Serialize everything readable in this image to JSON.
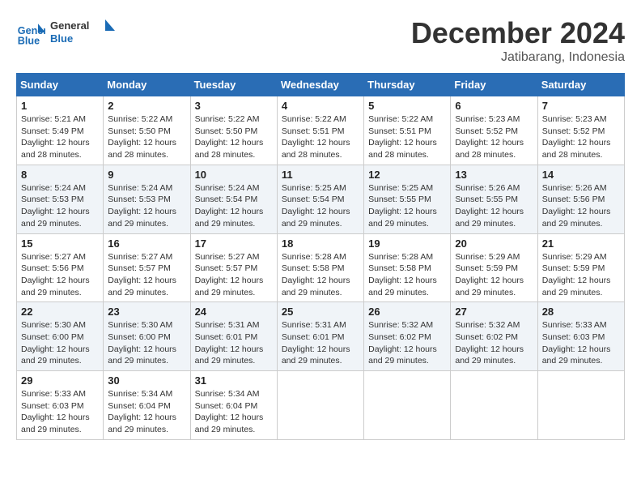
{
  "logo": {
    "line1": "General",
    "line2": "Blue"
  },
  "title": "December 2024",
  "location": "Jatibarang, Indonesia",
  "days_of_week": [
    "Sunday",
    "Monday",
    "Tuesday",
    "Wednesday",
    "Thursday",
    "Friday",
    "Saturday"
  ],
  "weeks": [
    [
      {
        "day": 1,
        "sunrise": "5:21 AM",
        "sunset": "5:49 PM",
        "daylight": "12 hours and 28 minutes."
      },
      {
        "day": 2,
        "sunrise": "5:22 AM",
        "sunset": "5:50 PM",
        "daylight": "12 hours and 28 minutes."
      },
      {
        "day": 3,
        "sunrise": "5:22 AM",
        "sunset": "5:50 PM",
        "daylight": "12 hours and 28 minutes."
      },
      {
        "day": 4,
        "sunrise": "5:22 AM",
        "sunset": "5:51 PM",
        "daylight": "12 hours and 28 minutes."
      },
      {
        "day": 5,
        "sunrise": "5:22 AM",
        "sunset": "5:51 PM",
        "daylight": "12 hours and 28 minutes."
      },
      {
        "day": 6,
        "sunrise": "5:23 AM",
        "sunset": "5:52 PM",
        "daylight": "12 hours and 28 minutes."
      },
      {
        "day": 7,
        "sunrise": "5:23 AM",
        "sunset": "5:52 PM",
        "daylight": "12 hours and 28 minutes."
      }
    ],
    [
      {
        "day": 8,
        "sunrise": "5:24 AM",
        "sunset": "5:53 PM",
        "daylight": "12 hours and 29 minutes."
      },
      {
        "day": 9,
        "sunrise": "5:24 AM",
        "sunset": "5:53 PM",
        "daylight": "12 hours and 29 minutes."
      },
      {
        "day": 10,
        "sunrise": "5:24 AM",
        "sunset": "5:54 PM",
        "daylight": "12 hours and 29 minutes."
      },
      {
        "day": 11,
        "sunrise": "5:25 AM",
        "sunset": "5:54 PM",
        "daylight": "12 hours and 29 minutes."
      },
      {
        "day": 12,
        "sunrise": "5:25 AM",
        "sunset": "5:55 PM",
        "daylight": "12 hours and 29 minutes."
      },
      {
        "day": 13,
        "sunrise": "5:26 AM",
        "sunset": "5:55 PM",
        "daylight": "12 hours and 29 minutes."
      },
      {
        "day": 14,
        "sunrise": "5:26 AM",
        "sunset": "5:56 PM",
        "daylight": "12 hours and 29 minutes."
      }
    ],
    [
      {
        "day": 15,
        "sunrise": "5:27 AM",
        "sunset": "5:56 PM",
        "daylight": "12 hours and 29 minutes."
      },
      {
        "day": 16,
        "sunrise": "5:27 AM",
        "sunset": "5:57 PM",
        "daylight": "12 hours and 29 minutes."
      },
      {
        "day": 17,
        "sunrise": "5:27 AM",
        "sunset": "5:57 PM",
        "daylight": "12 hours and 29 minutes."
      },
      {
        "day": 18,
        "sunrise": "5:28 AM",
        "sunset": "5:58 PM",
        "daylight": "12 hours and 29 minutes."
      },
      {
        "day": 19,
        "sunrise": "5:28 AM",
        "sunset": "5:58 PM",
        "daylight": "12 hours and 29 minutes."
      },
      {
        "day": 20,
        "sunrise": "5:29 AM",
        "sunset": "5:59 PM",
        "daylight": "12 hours and 29 minutes."
      },
      {
        "day": 21,
        "sunrise": "5:29 AM",
        "sunset": "5:59 PM",
        "daylight": "12 hours and 29 minutes."
      }
    ],
    [
      {
        "day": 22,
        "sunrise": "5:30 AM",
        "sunset": "6:00 PM",
        "daylight": "12 hours and 29 minutes."
      },
      {
        "day": 23,
        "sunrise": "5:30 AM",
        "sunset": "6:00 PM",
        "daylight": "12 hours and 29 minutes."
      },
      {
        "day": 24,
        "sunrise": "5:31 AM",
        "sunset": "6:01 PM",
        "daylight": "12 hours and 29 minutes."
      },
      {
        "day": 25,
        "sunrise": "5:31 AM",
        "sunset": "6:01 PM",
        "daylight": "12 hours and 29 minutes."
      },
      {
        "day": 26,
        "sunrise": "5:32 AM",
        "sunset": "6:02 PM",
        "daylight": "12 hours and 29 minutes."
      },
      {
        "day": 27,
        "sunrise": "5:32 AM",
        "sunset": "6:02 PM",
        "daylight": "12 hours and 29 minutes."
      },
      {
        "day": 28,
        "sunrise": "5:33 AM",
        "sunset": "6:03 PM",
        "daylight": "12 hours and 29 minutes."
      }
    ],
    [
      {
        "day": 29,
        "sunrise": "5:33 AM",
        "sunset": "6:03 PM",
        "daylight": "12 hours and 29 minutes."
      },
      {
        "day": 30,
        "sunrise": "5:34 AM",
        "sunset": "6:04 PM",
        "daylight": "12 hours and 29 minutes."
      },
      {
        "day": 31,
        "sunrise": "5:34 AM",
        "sunset": "6:04 PM",
        "daylight": "12 hours and 29 minutes."
      },
      null,
      null,
      null,
      null
    ]
  ],
  "labels": {
    "sunrise": "Sunrise:",
    "sunset": "Sunset:",
    "daylight": "Daylight:"
  }
}
